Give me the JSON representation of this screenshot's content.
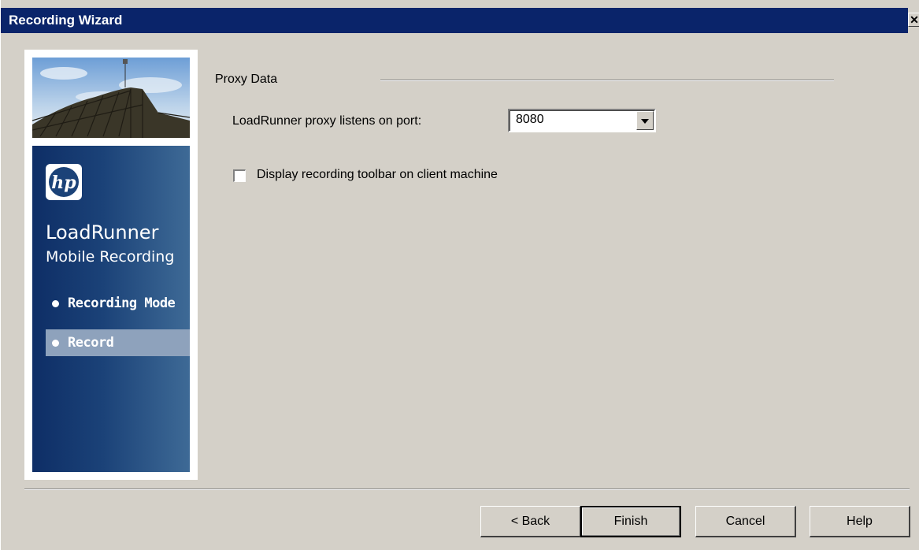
{
  "window": {
    "title": "Recording Wizard",
    "close_glyph": "✕"
  },
  "banner": {
    "logo": "hp",
    "product_name": "LoadRunner",
    "product_sub": "Mobile Recording",
    "steps": [
      {
        "label": "Recording Mode",
        "active": false
      },
      {
        "label": "Record",
        "active": true
      }
    ]
  },
  "proxy": {
    "group_label": "Proxy Data",
    "port_label": "LoadRunner proxy listens on port:",
    "port_value": "8080",
    "toolbar_checkbox_label": "Display recording toolbar on client machine",
    "toolbar_checked": false
  },
  "buttons": {
    "back": "< Back",
    "finish": "Finish",
    "cancel": "Cancel",
    "help": "Help"
  },
  "colors": {
    "titlebar": "#0a246a",
    "dialog_bg": "#d4d0c8",
    "banner_blue": "#1b4278",
    "active_step": "#8ea2bc"
  }
}
